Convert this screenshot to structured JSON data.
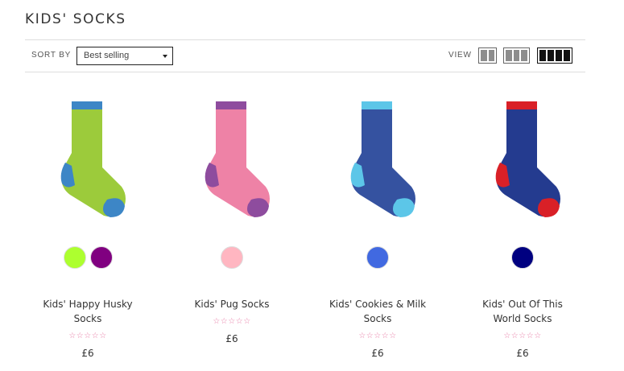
{
  "page": {
    "title": "KIDS' SOCKS"
  },
  "toolbar": {
    "sort_label": "SORT BY",
    "sort_value": "Best selling",
    "view_label": "VIEW"
  },
  "products": [
    {
      "name_line1": "Kids' Happy Husky",
      "name_line2": "Socks",
      "stars": "☆☆☆☆☆",
      "price": "£6",
      "swatches": [
        "#adff2f",
        "#800080"
      ],
      "colors": {
        "body": "#9ccb3b",
        "cuff": "#3d86c6",
        "heel": "#3d86c6",
        "toe": "#3d86c6"
      }
    },
    {
      "name_line1": "Kids' Pug Socks",
      "name_line2": "",
      "stars": "☆☆☆☆☆",
      "price": "£6",
      "swatches": [
        "#ffb6c1"
      ],
      "colors": {
        "body": "#ee82a6",
        "cuff": "#8e4c9e",
        "heel": "#8e4c9e",
        "toe": "#8e4c9e"
      }
    },
    {
      "name_line1": "Kids' Cookies & Milk",
      "name_line2": "Socks",
      "stars": "☆☆☆☆☆",
      "price": "£6",
      "swatches": [
        "#4169e1"
      ],
      "colors": {
        "body": "#3552a0",
        "cuff": "#5cc6e8",
        "heel": "#5cc6e8",
        "toe": "#5cc6e8"
      }
    },
    {
      "name_line1": "Kids' Out Of This",
      "name_line2": "World Socks",
      "stars": "☆☆☆☆☆",
      "price": "£6",
      "swatches": [
        "#000080"
      ],
      "colors": {
        "body": "#243b8f",
        "cuff": "#d92027",
        "heel": "#d92027",
        "toe": "#d92027"
      }
    }
  ]
}
